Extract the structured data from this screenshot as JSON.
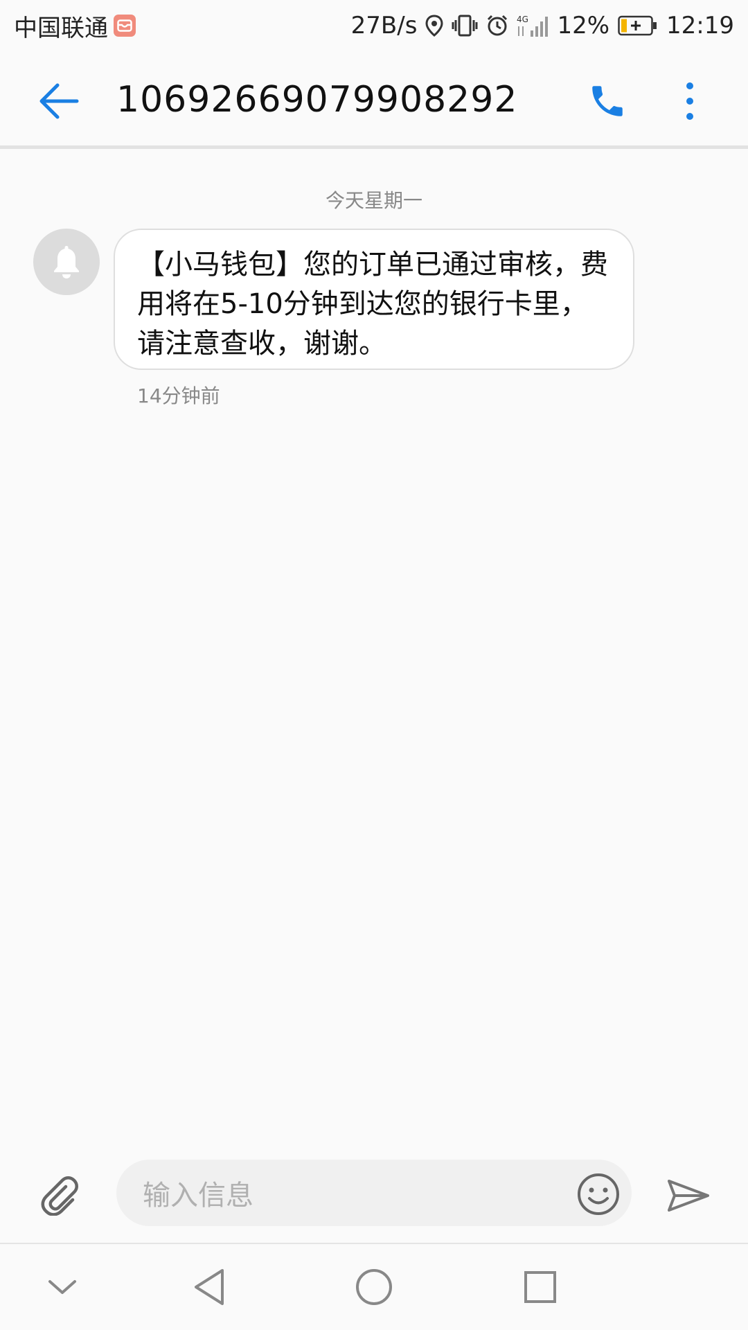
{
  "status_bar": {
    "carrier": "中国联通",
    "net_speed": "27B/s",
    "battery_percent": "12%",
    "time": "12:19",
    "icons": [
      "location-icon",
      "vibrate-icon",
      "alarm-icon",
      "signal-4g-icon",
      "battery-charging-icon"
    ]
  },
  "header": {
    "contact": "10692669079908292",
    "back_icon": "arrow-left-icon",
    "call_icon": "phone-icon",
    "more_icon": "more-vert-icon",
    "accent_color": "#1a7fe3"
  },
  "conversation": {
    "date_label": "今天星期一",
    "messages": [
      {
        "sender_icon": "bell-icon",
        "text": "【小马钱包】您的订单已通过审核，费用将在5-10分钟到达您的银行卡里，请注意查收，谢谢。",
        "timestamp": "14分钟前"
      }
    ]
  },
  "composer": {
    "placeholder": "输入信息",
    "attach_icon": "paperclip-icon",
    "emoji_icon": "emoji-icon",
    "send_icon": "send-icon"
  },
  "nav_bar": {
    "icons": [
      "collapse-icon",
      "back-icon",
      "home-icon",
      "recents-icon"
    ]
  }
}
